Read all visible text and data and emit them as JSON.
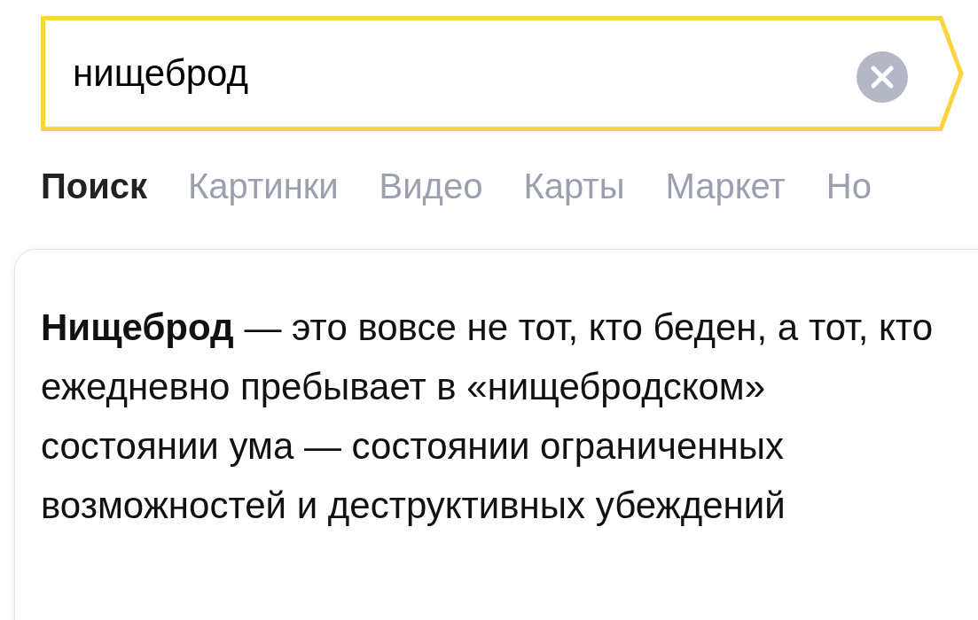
{
  "search": {
    "value": "нищеброд"
  },
  "tabs": [
    {
      "label": "Поиск",
      "selected": true
    },
    {
      "label": "Картинки",
      "selected": false
    },
    {
      "label": "Видео",
      "selected": false
    },
    {
      "label": "Карты",
      "selected": false
    },
    {
      "label": "Маркет",
      "selected": false
    },
    {
      "label": "Но",
      "selected": false
    }
  ],
  "card": {
    "text": "**Нищеброд** — это вовсе не тот, кто беден, а тот, кто ежедневно пребывает в «нищебродском» состоянии ума — состоянии ограниченных возможностей и деструктивных убеждений"
  }
}
